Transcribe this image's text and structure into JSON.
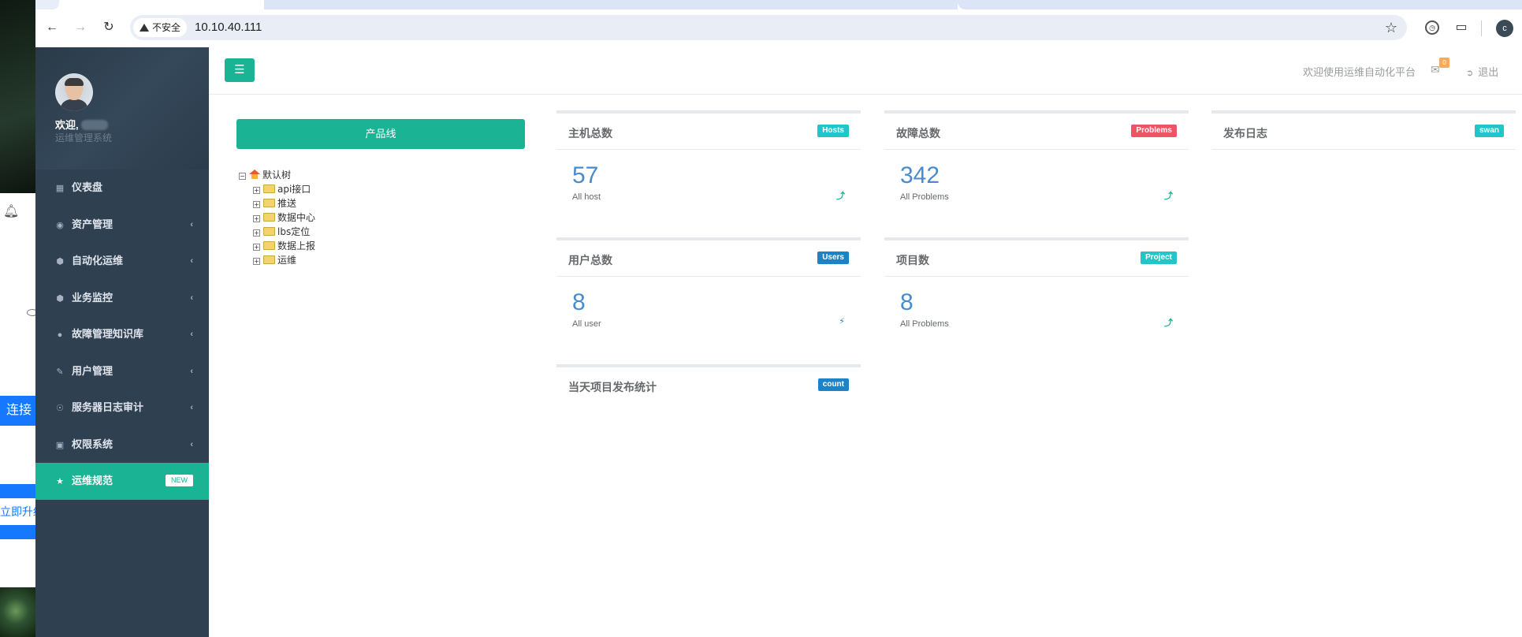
{
  "underlying_window": {
    "connect_label": "连接",
    "upgrade_label": "立即升级"
  },
  "browser": {
    "security_label": "不安全",
    "url": "10.10.40.111",
    "profile_initial": "c"
  },
  "sidebar": {
    "welcome": "欢迎,",
    "system_name": "运维管理系统",
    "items": [
      {
        "label": "仪表盘",
        "icon": "grid-icon",
        "has_arrow": false
      },
      {
        "label": "资产管理",
        "icon": "assets-icon",
        "has_arrow": true
      },
      {
        "label": "自动化运维",
        "icon": "cube-icon",
        "has_arrow": true
      },
      {
        "label": "业务监控",
        "icon": "cube-icon",
        "has_arrow": true
      },
      {
        "label": "故障管理知识库",
        "icon": "bomb-icon",
        "has_arrow": true
      },
      {
        "label": "用户管理",
        "icon": "edit-icon",
        "has_arrow": true
      },
      {
        "label": "服务器日志审计",
        "icon": "eye-icon",
        "has_arrow": true
      },
      {
        "label": "权限系统",
        "icon": "briefcase-icon",
        "has_arrow": true
      },
      {
        "label": "运维规范",
        "icon": "star-icon",
        "has_arrow": false,
        "badge": "NEW",
        "active": true
      }
    ]
  },
  "topbar": {
    "welcome_text": "欢迎使用运维自动化平台",
    "mail_count": "0",
    "logout_label": "退出"
  },
  "product_line_button": "产品线",
  "tree": {
    "root": "默认树",
    "children": [
      "api接口",
      "推送",
      "数据中心",
      "lbs定位",
      "数据上报",
      "运维"
    ]
  },
  "widgets": {
    "hosts": {
      "title": "主机总数",
      "label": "Hosts",
      "value": "57",
      "sub": "All host",
      "stat_icon": "level-up-icon"
    },
    "problems": {
      "title": "故障总数",
      "label": "Problems",
      "value": "342",
      "sub": "All Problems",
      "stat_icon": "level-up-icon"
    },
    "release_log": {
      "title": "发布日志",
      "label": "swan"
    },
    "users": {
      "title": "用户总数",
      "label": "Users",
      "value": "8",
      "sub": "All user",
      "stat_icon": "bolt-icon"
    },
    "projects": {
      "title": "项目数",
      "label": "Project",
      "value": "8",
      "sub": "All Problems",
      "stat_icon": "level-up-icon"
    },
    "daily_release": {
      "title": "当天项目发布统计",
      "label": "count"
    }
  },
  "colors": {
    "sidebar_bg": "#2f4050",
    "accent_green": "#1ab394",
    "label_cyan": "#23c6c8",
    "label_red": "#ed5565",
    "label_blue": "#1c84c6",
    "number_blue": "#4a8bcc"
  }
}
